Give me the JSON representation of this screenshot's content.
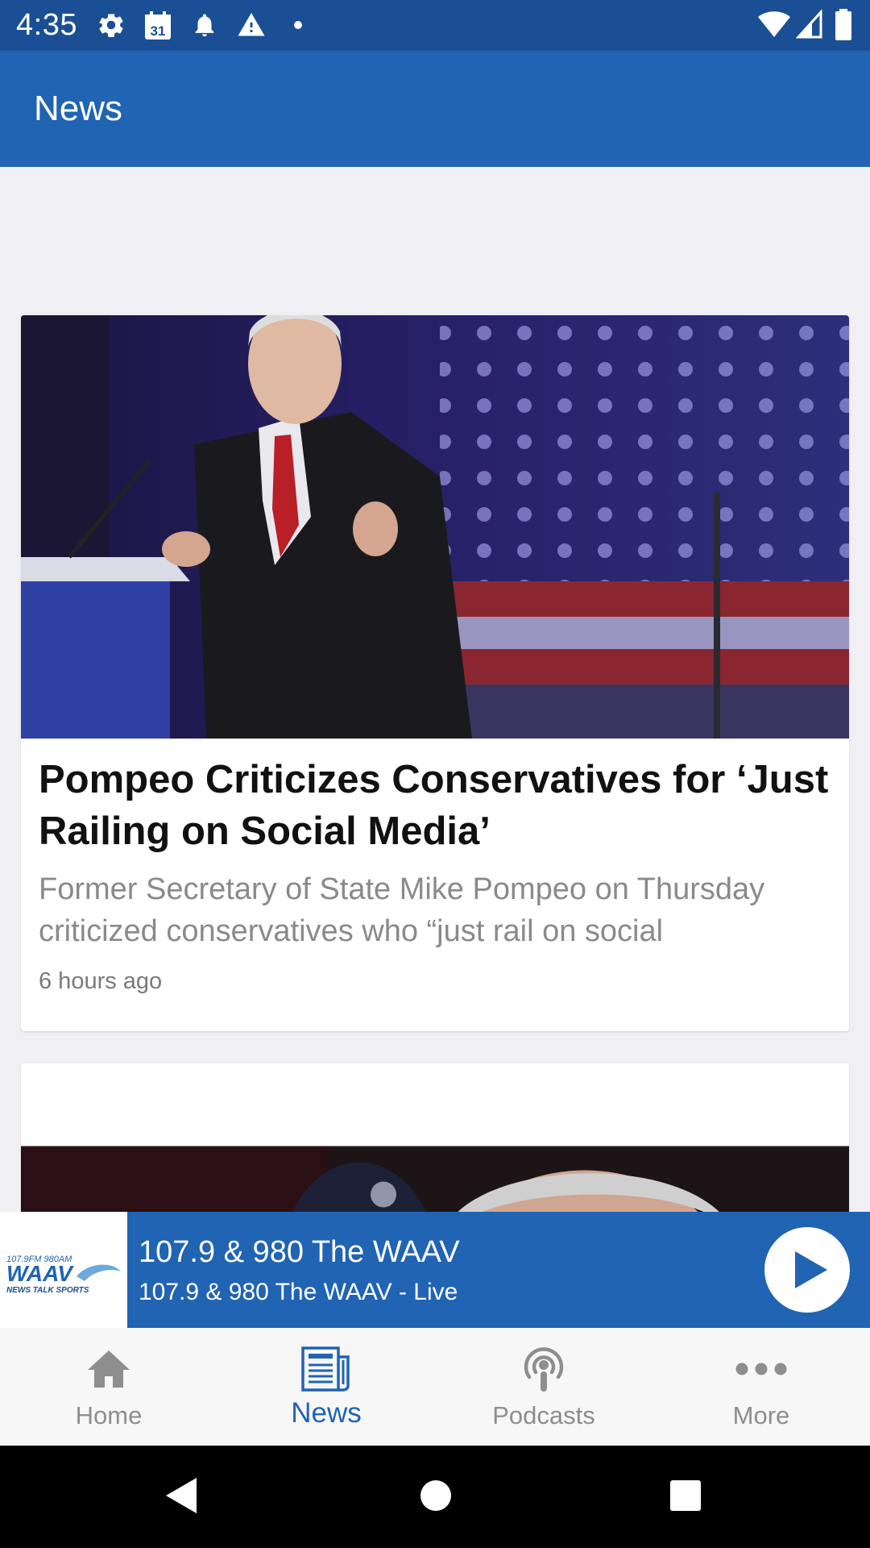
{
  "status_bar": {
    "time": "4:35",
    "calendar_day": "31",
    "icons": [
      "gear-icon",
      "calendar-icon",
      "bell-icon",
      "warning-icon",
      "dot-icon",
      "wifi-icon",
      "signal-icon",
      "battery-icon"
    ]
  },
  "app_bar": {
    "title": "News"
  },
  "articles": [
    {
      "title": "Pompeo Criticizes Conservatives for ‘Just Railing on Social Media’",
      "description": "Former Secretary of State Mike Pompeo on Thursday criticized conservatives who “just rail on social",
      "time": "6 hours ago"
    }
  ],
  "player": {
    "logo_text": "107.9FM 980AM WAAV NEWS TALK SPORTS",
    "station": "107.9 & 980 The WAAV",
    "subtitle": "107.9 & 980 The WAAV - Live",
    "icon": "play-icon"
  },
  "bottom_nav": {
    "items": [
      {
        "label": "Home",
        "icon": "home-icon",
        "active": false
      },
      {
        "label": "News",
        "icon": "newspaper-icon",
        "active": true
      },
      {
        "label": "Podcasts",
        "icon": "podcast-icon",
        "active": false
      },
      {
        "label": "More",
        "icon": "more-icon",
        "active": false
      }
    ]
  },
  "system_nav": {
    "icons": [
      "back-icon",
      "home-circle-icon",
      "recents-icon"
    ]
  },
  "colors": {
    "status_bar": "#1b4f95",
    "primary": "#2064b3",
    "background": "#efeff4",
    "nav_inactive": "#8e8e8e"
  }
}
